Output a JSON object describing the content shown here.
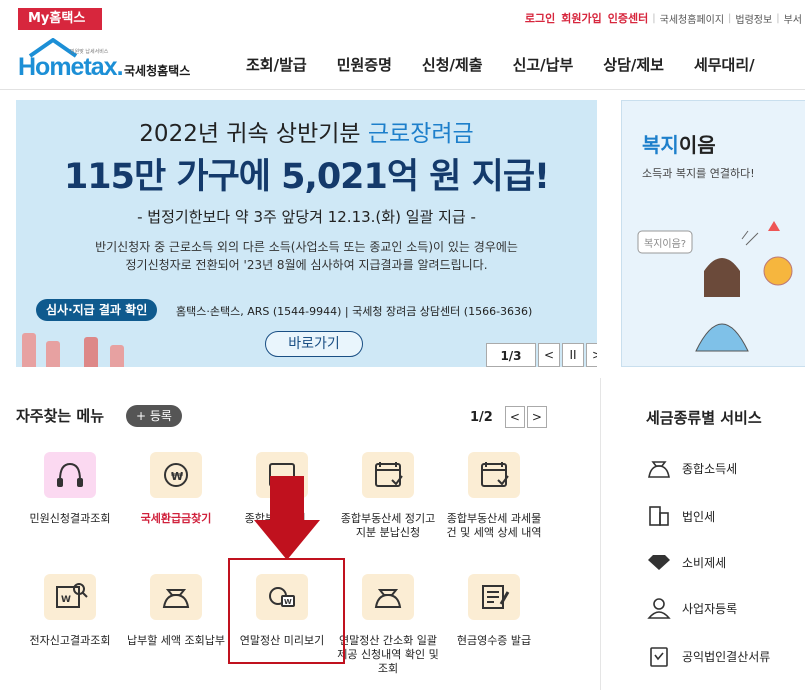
{
  "topbar": {
    "my_tab": "My홈택스",
    "links": [
      "로그인",
      "회원가입",
      "인증센터"
    ],
    "sublinks": [
      "국세청홈페이지",
      "법령정보",
      "부서"
    ]
  },
  "header": {
    "logo_word": "Hometax.",
    "logo_ko": "국세청홈택스",
    "logo_small": "민원맞 납세서비스",
    "nav": [
      "조회/발급",
      "민원증명",
      "신청/제출",
      "신고/납부",
      "상담/제보",
      "세무대리/"
    ]
  },
  "banner": {
    "title_prefix": "2022년 귀속 상반기분 ",
    "title_highlight": "근로장려금",
    "big": "115만 가구에 5,021억 원 지급!",
    "sub": "- 법정기한보다 약 3주 앞당겨 12.13.(화) 일괄 지급 -",
    "desc_line1": "반기신청자 중 근로소득 외의 다른 소득(사업소득 또는 종교인 소득)이 있는 경우에는",
    "desc_line2": "정기신청자로 전환되어 '23년 8월에 심사하여 지급결과를 알려드립니다.",
    "pill": "심사·지급 결과 확인",
    "pill_text": "홈택스·손택스, ARS (1544-9944) | 국세청 장려금 상담센터 (1566-3636)",
    "go_button": "바로가기",
    "page": "1/3",
    "prev": "<",
    "pause": "II",
    "next": ">"
  },
  "welfare": {
    "title_hl": "복지",
    "title_rest": "이음",
    "sub": "소득과 복지를 연결하다!",
    "bubble": "복지이음?"
  },
  "frequent": {
    "title": "자주찾는 메뉴",
    "register": "+ 등록",
    "page": "1/2",
    "prev": "<",
    "next": ">",
    "items": [
      {
        "label": "민원신청결과조회",
        "icon": "headset-icon"
      },
      {
        "label": "국세환급금찾기",
        "icon": "refund-icon"
      },
      {
        "label": "종합부동산세 ...",
        "icon": "calendar-icon"
      },
      {
        "label": "종합부동산세 정기고지분 분납신청",
        "icon": "calendar-check-icon"
      },
      {
        "label": "종합부동산세 과세물건 및 세액 상세 내역",
        "icon": "calendar-check-icon"
      },
      {
        "label": "전자신고결과조회",
        "icon": "search-doc-icon"
      },
      {
        "label": "납부할 세액 조회납부",
        "icon": "money-bag-icon"
      },
      {
        "label": "연말정산 미리보기",
        "icon": "preview-icon"
      },
      {
        "label": "연말정산 간소화 일괄제공 신청내역 확인 및 조회",
        "icon": "money-bag-icon"
      },
      {
        "label": "현금영수증 발급",
        "icon": "receipt-icon"
      }
    ]
  },
  "services": {
    "title": "세금종류별 서비스",
    "items": [
      "종합소득세",
      "법인세",
      "소비제세",
      "사업자등록",
      "공익법인결산서류"
    ]
  },
  "colors": {
    "accent_red": "#d7263d",
    "brand_blue": "#1c8fd6",
    "banner_bg": "#cfe8f6",
    "arrow_red": "#c0111e"
  }
}
